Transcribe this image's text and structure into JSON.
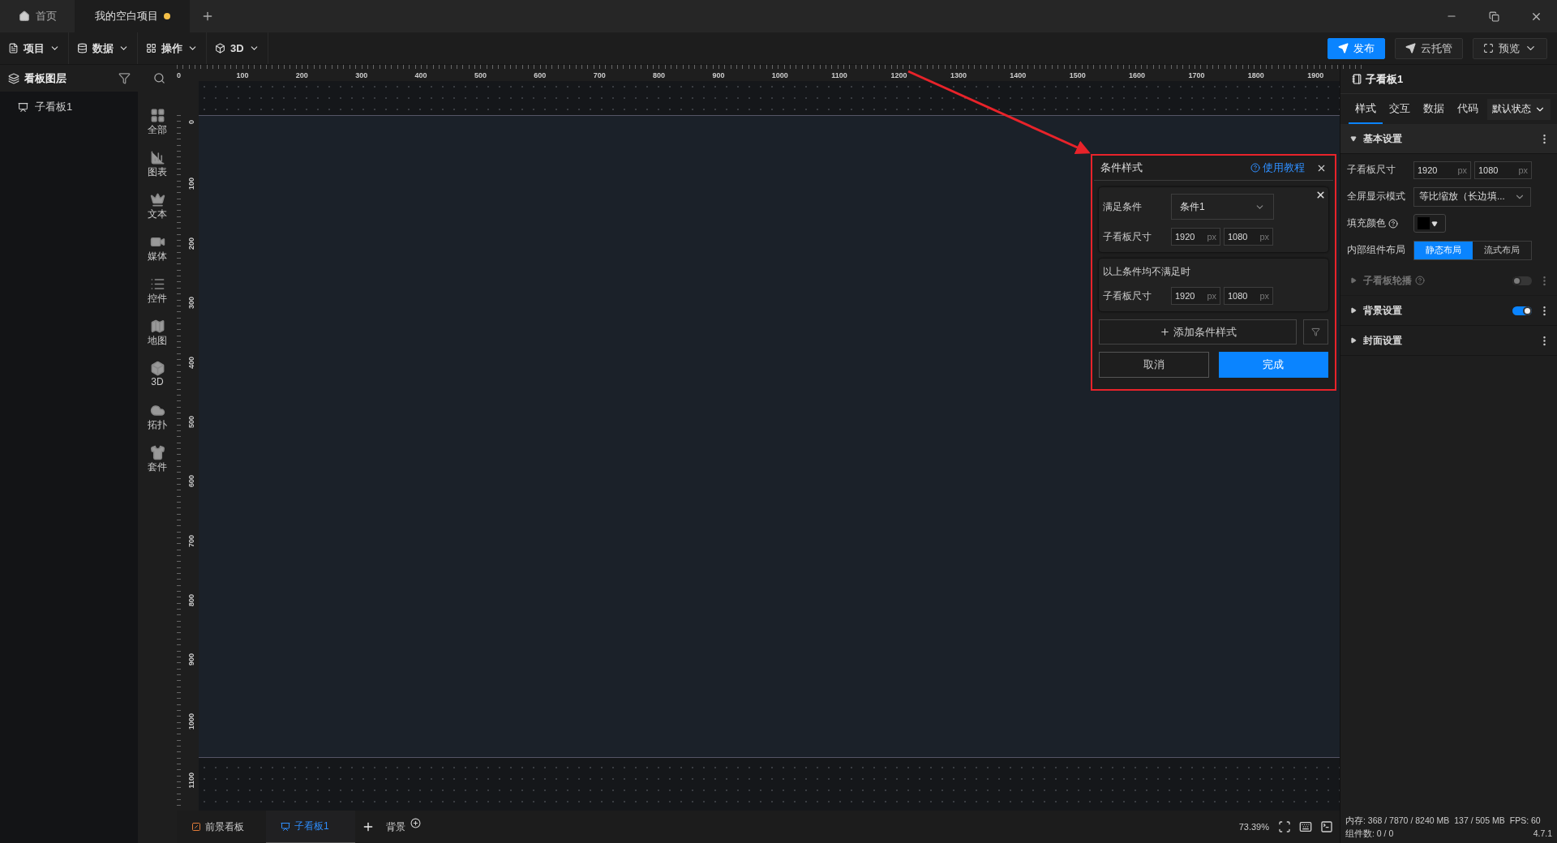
{
  "tabs": [
    {
      "label": "首页",
      "selected": false,
      "unsaved": false
    },
    {
      "label": "我的空白项目",
      "selected": true,
      "unsaved": true
    }
  ],
  "menus": [
    "项目",
    "数据",
    "操作",
    "3D"
  ],
  "actions": [
    {
      "label": "发布",
      "primary": true
    },
    {
      "label": "云托管",
      "primary": false
    },
    {
      "label": "预览",
      "primary": false
    }
  ],
  "layers": {
    "title": "看板图层",
    "items": [
      "子看板1"
    ]
  },
  "library": [
    "全部",
    "图表",
    "文本",
    "媒体",
    "控件",
    "地图",
    "3D",
    "拓扑",
    "套件"
  ],
  "ruler": {
    "horizontal": [
      "0",
      "100",
      "200",
      "300",
      "400",
      "500",
      "600",
      "700",
      "800",
      "900",
      "1000",
      "1100",
      "1200",
      "1300",
      "1400",
      "1500",
      "1600",
      "1700",
      "1800",
      "1900"
    ],
    "vertical": [
      "0",
      "100",
      "200",
      "300",
      "400",
      "500",
      "600",
      "700",
      "800",
      "900",
      "1000",
      "1100"
    ]
  },
  "dialog": {
    "title": "条件样式",
    "help_link": "使用教程",
    "conditions": [
      {
        "label": "满足条件",
        "select": "条件1",
        "size_label": "子看板尺寸",
        "width": {
          "value": "1920",
          "unit": "px"
        },
        "height": {
          "value": "1080",
          "unit": "px"
        }
      }
    ],
    "fallback": {
      "label": "以上条件均不满足时",
      "size_label": "子看板尺寸",
      "width": {
        "value": "1920",
        "unit": "px"
      },
      "height": {
        "value": "1080",
        "unit": "px"
      }
    },
    "add_button": "添加条件样式",
    "cancel": "取消",
    "confirm": "完成"
  },
  "inspector": {
    "title": "子看板1",
    "tabs": [
      {
        "label": "样式",
        "selected": true
      },
      {
        "label": "交互",
        "selected": false
      },
      {
        "label": "数据",
        "selected": false
      },
      {
        "label": "代码",
        "selected": false
      }
    ],
    "state_select": "默认状态",
    "sections": [
      {
        "title": "基本设置",
        "expanded": true,
        "disabled": false,
        "help": false
      },
      {
        "title": "子看板轮播",
        "expanded": false,
        "disabled": true,
        "help": true,
        "switch_on": false
      },
      {
        "title": "背景设置",
        "expanded": false,
        "disabled": false,
        "help": false,
        "switch_on": true
      },
      {
        "title": "封面设置",
        "expanded": false,
        "disabled": false,
        "help": false
      }
    ],
    "fields": [
      {
        "kind": "size",
        "label": "子看板尺寸",
        "help": false,
        "width": {
          "value": "1920",
          "unit": "px"
        },
        "height": {
          "value": "1080",
          "unit": "px"
        }
      },
      {
        "kind": "select",
        "label": "全屏显示模式",
        "help": false,
        "value": "等比缩放（长边填..."
      },
      {
        "kind": "color",
        "label": "填充颜色",
        "help": true,
        "color": "#000000"
      },
      {
        "kind": "segmented",
        "label": "内部组件布局",
        "help": false,
        "options": [
          {
            "label": "静态布局",
            "selected": true
          },
          {
            "label": "流式布局",
            "selected": false
          }
        ]
      }
    ]
  },
  "bottom": {
    "tabs": [
      {
        "label": "前景看板",
        "selected": false
      },
      {
        "label": "子看板1",
        "selected": true
      }
    ],
    "background": "背景",
    "zoom": "73.39%"
  },
  "status": {
    "memory": "内存: 368 / 7870 / 8240 MB",
    "gpu": "137 / 505 MB",
    "fps": "FPS: 60",
    "count": "组件数: 0 / 0",
    "version": "4.7.1"
  }
}
